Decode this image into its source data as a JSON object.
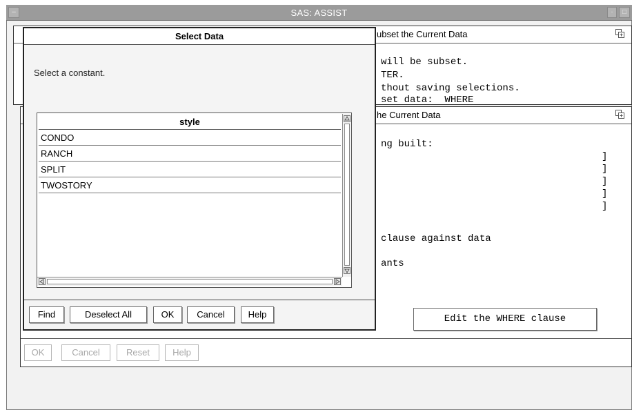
{
  "window": {
    "title": "SAS: ASSIST"
  },
  "subset_panel": {
    "title": "ubset the Current Data",
    "lines": [
      "will be subset.",
      "TER.",
      "thout saving selections.",
      "set data:  WHERE"
    ]
  },
  "where_panel": {
    "title": "he Current Data",
    "line_built": "ng built:",
    "bracket": "]",
    "line_clause": "clause against data",
    "line_constants": "ants",
    "edit_button": "Edit the WHERE clause"
  },
  "bottom_buttons": {
    "ok": "OK",
    "cancel": "Cancel",
    "reset": "Reset",
    "help": "Help"
  },
  "dialog": {
    "title": "Select Data",
    "prompt": "Select a constant.",
    "column_header": "style",
    "rows": [
      "CONDO",
      "RANCH",
      "SPLIT",
      "TWOSTORY"
    ],
    "buttons": {
      "find": "Find",
      "deselect_all": "Deselect All",
      "ok": "OK",
      "cancel": "Cancel",
      "help": "Help"
    }
  }
}
